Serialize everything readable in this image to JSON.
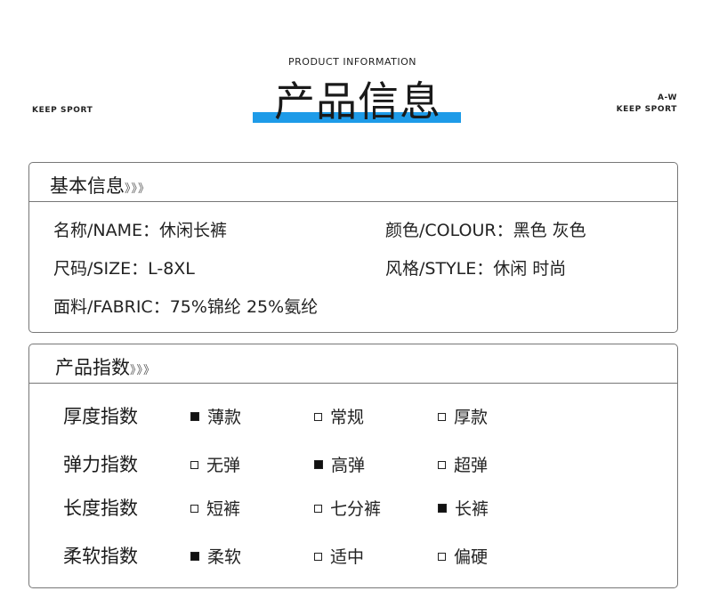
{
  "header": {
    "subtitle_en": "PRODUCT INFORMATION",
    "title": "产品信息",
    "left_tag": "KEEP SPORT",
    "right_tag_top": "A-W",
    "right_tag_bottom": "KEEP SPORT",
    "accent_color": "#1e9be8"
  },
  "basic": {
    "title": "基本信息",
    "chevrons": "》》》",
    "name": "名称/NAME：休闲长裤",
    "colour": "颜色/COLOUR：黑色 灰色",
    "size": "尺码/SIZE：L-8XL",
    "style": "风格/STYLE：休闲 时尚",
    "fabric": "面料/FABRIC：75%锦纶 25%氨纶"
  },
  "index": {
    "title": "产品指数",
    "chevrons": "》》》",
    "rows": [
      {
        "label": "厚度指数",
        "options": [
          {
            "text": "薄款",
            "checked": true
          },
          {
            "text": "常规",
            "checked": false
          },
          {
            "text": "厚款",
            "checked": false
          }
        ]
      },
      {
        "label": "弹力指数",
        "options": [
          {
            "text": "无弹",
            "checked": false
          },
          {
            "text": "高弹",
            "checked": true
          },
          {
            "text": "超弹",
            "checked": false
          }
        ]
      },
      {
        "label": "长度指数",
        "options": [
          {
            "text": "短裤",
            "checked": false
          },
          {
            "text": "七分裤",
            "checked": false
          },
          {
            "text": "长裤",
            "checked": true
          }
        ]
      },
      {
        "label": "柔软指数",
        "options": [
          {
            "text": "柔软",
            "checked": true
          },
          {
            "text": "适中",
            "checked": false
          },
          {
            "text": "偏硬",
            "checked": false
          }
        ]
      }
    ]
  }
}
